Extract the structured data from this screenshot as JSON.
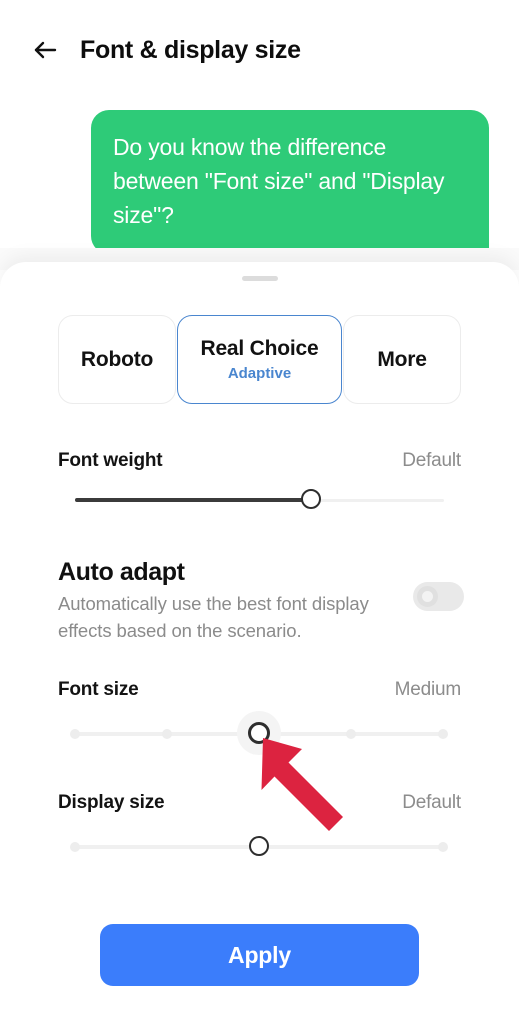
{
  "header": {
    "back_icon": "arrow-left-icon",
    "title": "Font & display size"
  },
  "chat": {
    "message": "Do you know the difference between \"Font size\" and \"Display size\"?",
    "bubble_color": "#2ECB78"
  },
  "sheet": {
    "handle": "drag-handle",
    "font_cards": [
      {
        "name": "Roboto",
        "subtitle": "",
        "selected": false
      },
      {
        "name": "Real Choice",
        "subtitle": "Adaptive",
        "selected": true
      },
      {
        "name": "More",
        "subtitle": "",
        "selected": false
      }
    ],
    "font_weight": {
      "label": "Font weight",
      "value": "Default",
      "percent": 64
    },
    "auto_adapt": {
      "title": "Auto adapt",
      "description": "Automatically use the best font display effects based on the scenario.",
      "toggle_state": "off"
    },
    "font_size": {
      "label": "Font size",
      "value": "Medium",
      "steps": 5,
      "selected_index": 2
    },
    "display_size": {
      "label": "Display size",
      "value": "Default",
      "steps": 2,
      "selected_index": 1
    },
    "apply_label": "Apply",
    "apply_color": "#3B7DFB"
  },
  "annotation": {
    "arrow": "pointer-arrow-icon",
    "color": "#DC2340"
  }
}
